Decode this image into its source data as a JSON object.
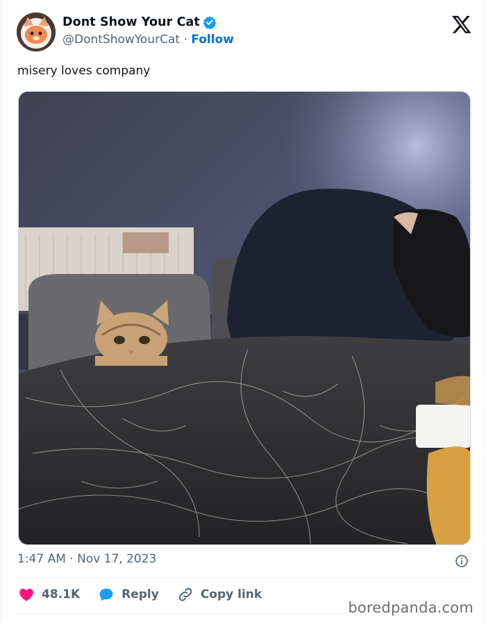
{
  "tweet": {
    "display_name": "Dont Show Your Cat",
    "handle": "@DontShowYourCat",
    "separator": "·",
    "follow_label": "Follow",
    "text": "misery loves company",
    "timestamp": "1:47 AM · Nov 17, 2023"
  },
  "actions": {
    "likes": "48.1K",
    "reply_label": "Reply",
    "copy_link_label": "Copy link"
  },
  "watermark": "boredpanda.com",
  "colors": {
    "verified": "#1d9bf0",
    "follow": "#006fd6",
    "heart": "#f91880",
    "reply": "#1d9bf0"
  },
  "icons": [
    "avatar",
    "verified-badge-icon",
    "x-logo-icon",
    "info-icon",
    "heart-icon",
    "reply-bubble-icon",
    "link-icon"
  ]
}
